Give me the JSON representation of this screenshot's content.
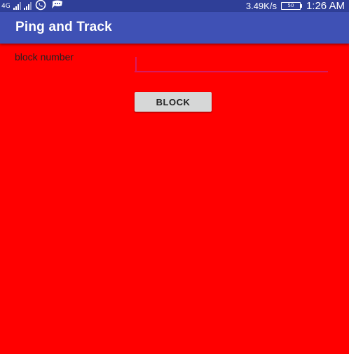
{
  "status_bar": {
    "network_type": "4G",
    "speed": "3.49K/s",
    "battery": "50",
    "time": "1:26 AM",
    "icons": [
      "signal-icon",
      "signal-icon",
      "whatsapp-icon",
      "chat-icon"
    ]
  },
  "app_bar": {
    "title": "Ping and Track",
    "color": "#3f51b5"
  },
  "form": {
    "label": "block number",
    "input_value": "",
    "button_label": "BLOCK",
    "background_color": "#ff0000",
    "accent_color": "#d81b60"
  }
}
